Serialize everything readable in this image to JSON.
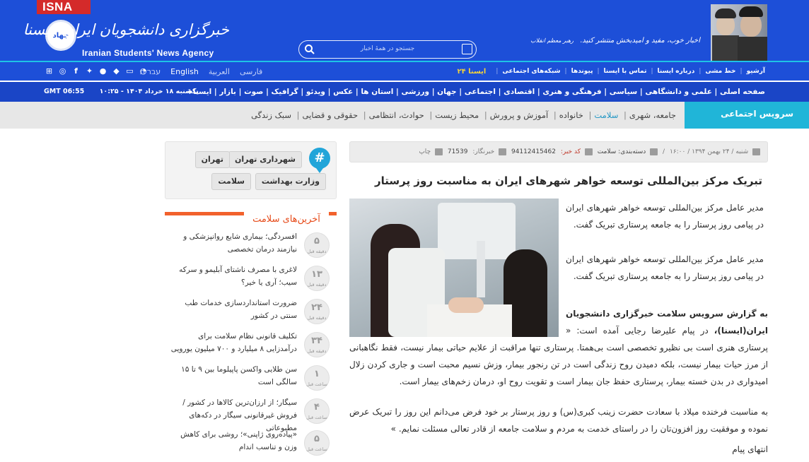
{
  "header": {
    "isna_tag": "ISNA",
    "logo_fa": "خبرگزاری دانشجویان ایران، ایسنا",
    "logo_en": "Iranian Students' News Agency",
    "emblem": "جهاد",
    "search_placeholder": "جستجو در همهٔ اخبار",
    "slogan": "اخبار خوب، مفید و امیدبخش منتشر کنید.",
    "slogan_sig": "رهبر معظم انقلاب"
  },
  "utility": {
    "links": [
      "آرشیو",
      "خط مشی",
      "درباره ایسنا",
      "تماس با ایسنا",
      "پیوندها",
      "شبکه‌های اجتماعی"
    ],
    "isna24": "ایسنا ۲۴",
    "languages": [
      "فارسی",
      "العربية",
      "English",
      "עברית"
    ],
    "active_language": "English",
    "social_icons": [
      "windows-icon",
      "instagram-icon",
      "facebook-icon",
      "twitter-icon",
      "apple-icon",
      "android-icon",
      "tv-icon",
      "rss-icon"
    ]
  },
  "main_nav": {
    "links": "صفحه اصلی | علمی و دانشگاهی | سیاسی | فرهنگی و هنری | اقتصادی | اجتماعی | جهان | ورزشی | استان ها | عکس | ویدئو | گرافیک | صوت | بازار | ایسنا+",
    "date": "یکشنبه ۱۸ خرداد ۱۴۰۴ - ۱۰:۲۵",
    "gmt": "GMT 06:55"
  },
  "sub_nav": {
    "service": "سرویس اجتماعی",
    "links": [
      "جامعه، شهری",
      "سلامت",
      "خانواده",
      "آموزش و پرورش",
      "محیط زیست",
      "حوادث، انتظامی",
      "حقوقی و قضایی",
      "سبک زندگی"
    ],
    "highlighted": "سلامت"
  },
  "article": {
    "date": "شنبه / ۲۴ بهمن ۱۳۹۴ / ۱۶:۰۰",
    "category": "دسته‌بندی: سلامت",
    "code_label": "کد خبر:",
    "code": "94112415462",
    "reporter_label": "خبرنگار:",
    "reporter": "71539",
    "print": "چاپ",
    "headline": "تبریک مرکز بین‌المللی توسعه خواهر شهرهای ایران به مناسبت روز پرستار",
    "lead1": "مدیر عامل مرکز بین‌المللی توسعه خواهر شهرهای ایران در پیامی روز پرستار را به جامعه پرستاری تبریک گفت.",
    "lead2": "مدیر عامل مرکز بین‌المللی توسعه خواهر شهرهای ایران در پیامی روز پرستار را به جامعه پرستاری تبریک گفت.",
    "body_source": "به گزارش سرویس سلامت خبرگزاری دانشجویان ایران(ایسنا)،",
    "body1": " در پیام علیرضا رجایی آمده است: « پرستاری هنری است بی نظیرو تخصصی است بی‌همتا. پرستاری تنها مراقبت از علایم حیاتی بیمار نیست، فقط نگاهبانی از مرز حیات بیمار نیست، بلکه دمیدن روح زندگی است در تن رنجور بیمار، وزش نسیم محبت است و جاری کردن زلال امیدواری در بدن خسته بیمار، پرستاری حفظ جان بیمار است و تقویت روح او، درمان زخم‌های بیمار است.",
    "body2": "به مناسبت فرخنده میلاد با سعادت حضرت زینب کبری(س) و روز پرستار بر خود فرض می‌دانم این روز را تبریک عرض نموده و موفقیت روز افزون‌تان را در راستای خدمت به مردم و سلامت جامعه از قادر تعالی مسئلت نمایم. »",
    "end": "انتهای پیام"
  },
  "sidebar": {
    "tags": [
      "شهرداری تهران",
      "تهران",
      "وزارت بهداشت",
      "سلامت"
    ],
    "latest_title": "آخرین‌های سلامت",
    "latest": [
      {
        "num": "۵",
        "unit": "دقیقه قبل",
        "text": "افسردگی؛ بیماری شایع روانپزشکی و نیازمند درمان تخصصی"
      },
      {
        "num": "۱۳",
        "unit": "دقیقه قبل",
        "text": "لاغری با مصرف ناشتای آبلیمو و سرکه سیب؛ آری یا خیر؟"
      },
      {
        "num": "۲۴",
        "unit": "دقیقه قبل",
        "text": "ضرورت استانداردسازی خدمات طب سنتی در کشور"
      },
      {
        "num": "۳۴",
        "unit": "دقیقه قبل",
        "text": "تکلیف قانونی نظام سلامت برای درآمدزایی ۸ میلیارد و ۷۰۰ میلیون یورویی"
      },
      {
        "num": "۱",
        "unit": "ساعت قبل",
        "text": "سن طلایی واکسن پاپیلوما بین ۹ تا ۱۵ سالگی است"
      },
      {
        "num": "۴",
        "unit": "ساعت قبل",
        "text": "سیگار؛ از ارزان‌ترین کالاها در کشور / فروش غیرقانونی سیگار در دکه‌های مطبوعاتی"
      },
      {
        "num": "۵",
        "unit": "ساعت قبل",
        "text": "«پیاده‌روی ژاپنی»؛ روشی برای کاهش وزن و تناسب اندام"
      }
    ]
  }
}
